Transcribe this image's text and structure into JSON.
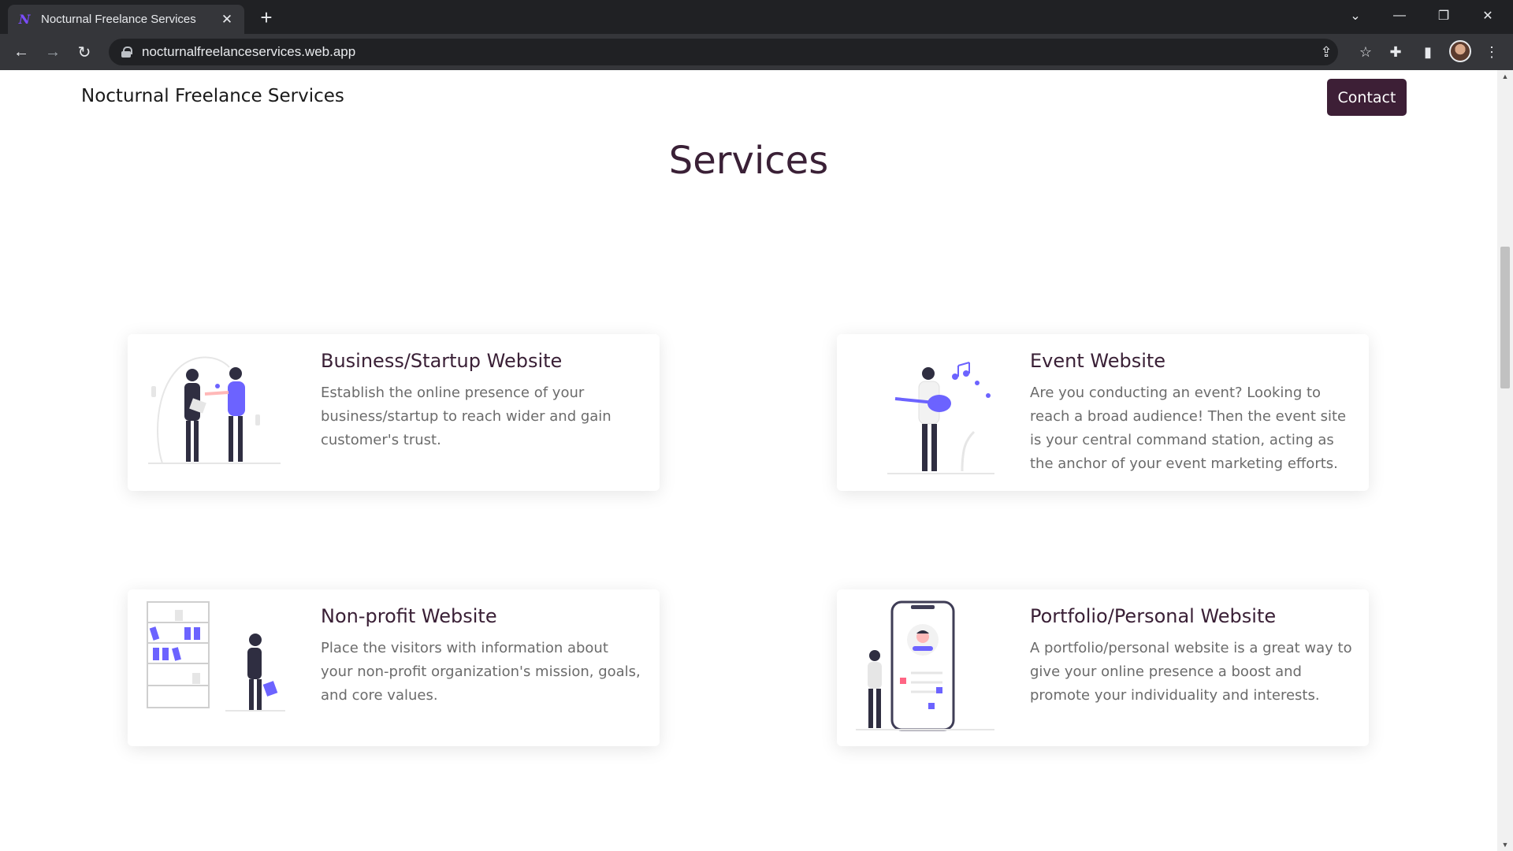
{
  "browser": {
    "tab_title": "Nocturnal Freelance Services",
    "tab_favicon": "N",
    "url": "nocturnalfreelanceservices.web.app"
  },
  "site": {
    "title": "Nocturnal Freelance Services",
    "contact_label": "Contact"
  },
  "services": {
    "heading": "Services",
    "cards": [
      {
        "title": "Business/Startup Website",
        "description": "Establish the online presence of your business/startup to reach wider and gain customer's trust.",
        "illustration": "handshake-illustration"
      },
      {
        "title": "Event Website",
        "description": "Are you conducting an event? Looking to reach a broad audience! Then the event site is your central command station, acting as the anchor of your event marketing efforts.",
        "illustration": "guitarist-illustration"
      },
      {
        "title": "Non-profit Website",
        "description": "Place the visitors with information about your non-profit organization's mission, goals, and core values.",
        "illustration": "bookshelf-illustration"
      },
      {
        "title": "Portfolio/Personal Website",
        "description": "A portfolio/personal website is a great way to give your online presence a boost and promote your individuality and interests.",
        "illustration": "phone-profile-illustration"
      }
    ]
  },
  "colors": {
    "accent": "#3d1f36",
    "illustration_purple": "#6c63ff"
  }
}
